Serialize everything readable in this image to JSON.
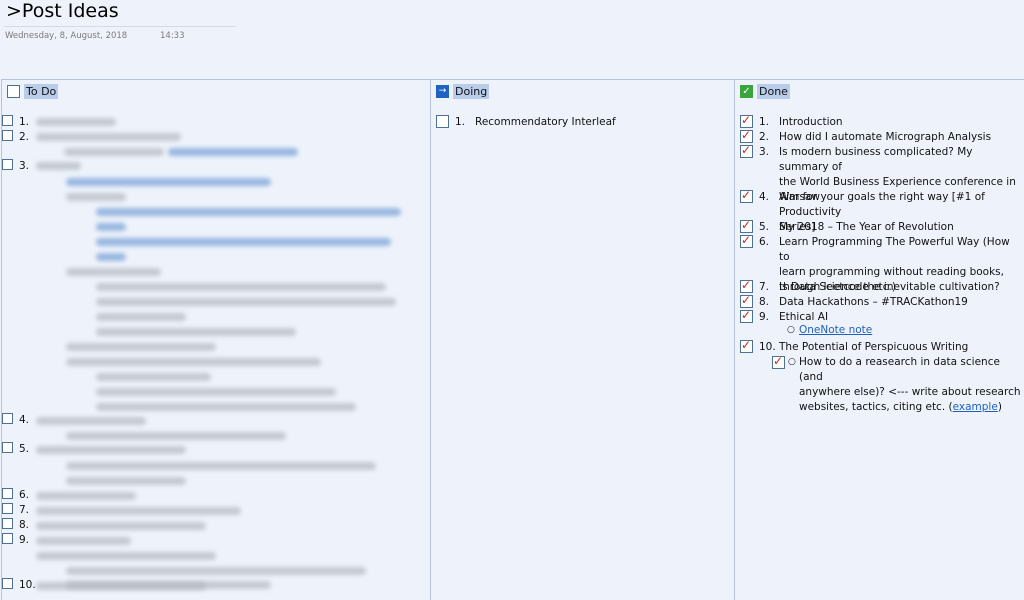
{
  "page": {
    "title": ">Post Ideas",
    "date": "Wednesday, 8, August, 2018",
    "time": "14:33"
  },
  "columns": {
    "todo": {
      "label": "To Do",
      "numbers": [
        "1.",
        "2.",
        "3.",
        "4.",
        "5.",
        "6.",
        "7.",
        "8.",
        "9.",
        "10."
      ]
    },
    "doing": {
      "label": "Doing",
      "items": [
        {
          "num": "1.",
          "text": "Recommendatory Interleaf"
        }
      ]
    },
    "done": {
      "label": "Done",
      "items": [
        {
          "num": "1.",
          "lines": [
            "Introduction"
          ]
        },
        {
          "num": "2.",
          "lines": [
            "How did I automate Micrograph Analysis"
          ]
        },
        {
          "num": "3.",
          "lines": [
            "Is modern business complicated? My summary of",
            "the World Business Experience conference in",
            "Warsaw"
          ]
        },
        {
          "num": "4.",
          "lines": [
            "Aim for your goals the right way [#1 of Productivity",
            "Series]"
          ]
        },
        {
          "num": "5.",
          "lines": [
            "My 2018 – The Year of Revolution"
          ]
        },
        {
          "num": "6.",
          "lines": [
            "Learn Programming The Powerful Way (How to",
            "learn programming without reading books,",
            "through leetcode etc.)"
          ]
        },
        {
          "num": "7.",
          "lines": [
            "Is Data Science the inevitable cultivation?"
          ]
        },
        {
          "num": "8.",
          "lines": [
            "Data Hackathons – #TRACKathon19"
          ]
        },
        {
          "num": "9.",
          "lines": [
            "Ethical AI"
          ]
        },
        {
          "num": "10.",
          "lines": [
            "The Potential of Perspicuous Writing"
          ]
        }
      ],
      "subitems": {
        "onenote_link": "OneNote note",
        "research_lines": [
          "How to do a reasearch in data science (and",
          "anywhere else)? <--- write about research"
        ],
        "research_last_prefix": "websites, tactics, citing etc. (",
        "research_link": "example",
        "research_last_suffix": ")"
      }
    }
  },
  "colors": {
    "background": "#eef3fb",
    "header_highlight": "#b9cdea",
    "check_red": "#c3261e",
    "doing_blue": "#1f63c2",
    "done_green": "#3aa63a",
    "link": "#1f5fbf"
  },
  "icons": {
    "todo": "empty-checkbox-icon",
    "doing": "arrow-right-icon",
    "done": "green-check-icon",
    "done_item": "red-check-checkbox-icon"
  }
}
